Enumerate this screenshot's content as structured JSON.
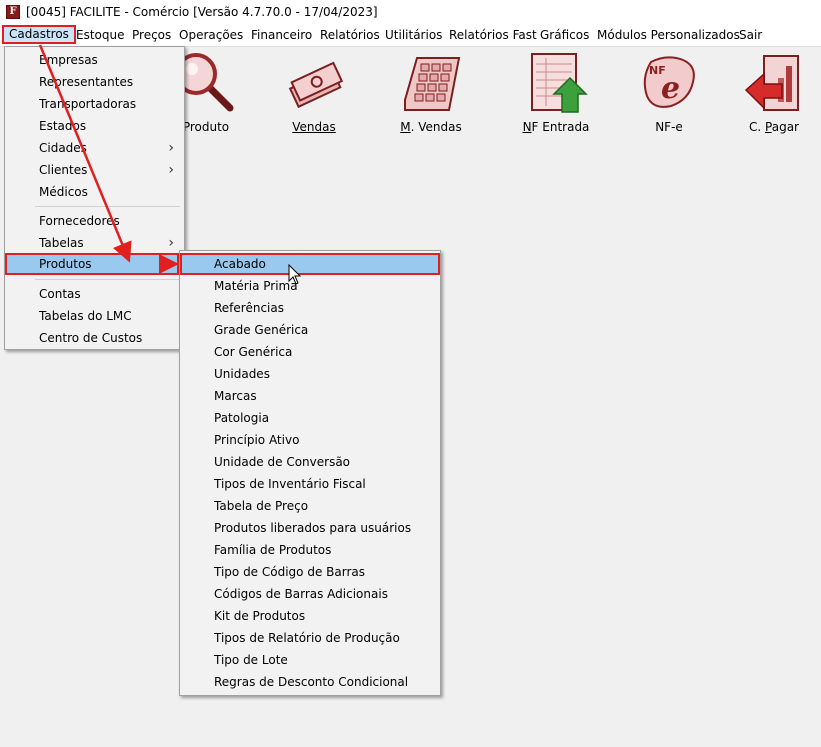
{
  "window": {
    "title": "[0045] FACILITE - Comércio [Versão 4.7.70.0 - 17/04/2023]",
    "icon": "F"
  },
  "menubar": {
    "items": [
      "Cadastros",
      "Estoque",
      "Preços",
      "Operações",
      "Financeiro",
      "Relatórios",
      "Utilitários",
      "Relatórios Fast",
      "Gráficos",
      "Módulos Personalizados",
      "Sair"
    ]
  },
  "toolbar": {
    "buttons": [
      {
        "label": "Produto",
        "icon": "magnifier-icon"
      },
      {
        "label": "Vendas",
        "icon": "money-icon"
      },
      {
        "label": "M. Vendas",
        "icon": "calculator-icon"
      },
      {
        "label": "NF Entrada",
        "icon": "invoice-entry-icon"
      },
      {
        "label": "NF-e",
        "icon": "nfe-icon"
      },
      {
        "label": "C. Pagar",
        "icon": "payables-icon"
      }
    ]
  },
  "cadastros_menu": {
    "items": [
      "Empresas",
      "Representantes",
      "Transportadoras",
      "Estados",
      "Cidades",
      "Clientes",
      "Médicos",
      "Fornecedores",
      "Tabelas",
      "Produtos",
      "Contas",
      "Tabelas do LMC",
      "Centro de Custos"
    ],
    "submenu_arrow": "›"
  },
  "produtos_submenu": {
    "items": [
      "Acabado",
      "Matéria Prima",
      "Referências",
      "Grade Genérica",
      "Cor Genérica",
      "Unidades",
      "Marcas",
      "Patologia",
      "Princípio Ativo",
      "Unidade de Conversão",
      "Tipos de Inventário Fiscal",
      "Tabela de Preço",
      "Produtos liberados para usuários",
      "Família de Produtos",
      "Tipo de Código de Barras",
      "Códigos de Barras Adicionais",
      "Kit de Produtos",
      "Tipos de Relatório de Produção",
      "Tipo de Lote",
      "Regras de Desconto Condicional"
    ]
  },
  "colors": {
    "highlight_border": "#e01f1f",
    "annotation_arrow": "#e01f1f",
    "menu_hover": "#99c9ef"
  }
}
